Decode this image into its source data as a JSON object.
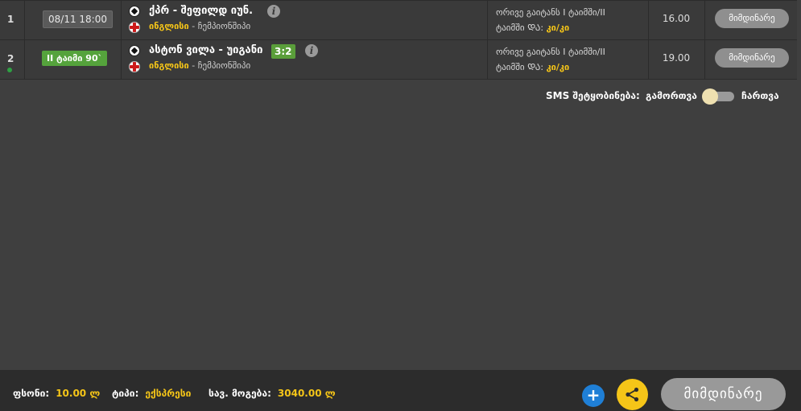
{
  "rows": [
    {
      "index": "1",
      "time": "08/11 18:00",
      "live": false,
      "teams": "ქპრ - შეფილდ იუნ.",
      "score": "",
      "country": "ინგლისი",
      "league": "ჩემპიონშიპი",
      "bet_line1": "ორივე გაიტანს I ტაიმში/II",
      "bet_line2_label": "ტაიმში ‍",
      "bet_line2_sep": "ᲓᲐ",
      "bet_line2_value": "კი/კი",
      "odd": "16.00",
      "status": "მიმდინარე"
    },
    {
      "index": "2",
      "time": "II ტაიმი 90`",
      "live": true,
      "teams": "ასტონ ვილა - უიგანი",
      "score": "3:2",
      "country": "ინგლისი",
      "league": "ჩემპიონშიპი",
      "bet_line1": "ორივე გაიტანს I ტაიმში/II",
      "bet_line2_label": "ტაიმში ‍",
      "bet_line2_sep": "ᲓᲐ",
      "bet_line2_value": "კი/კი",
      "odd": "19.00",
      "status": "მიმდინარე"
    }
  ],
  "sms": {
    "label": "SMS შეტყობინება:",
    "off_label": "გამორთვა",
    "on_label": "ჩართვა",
    "enabled": false
  },
  "footer": {
    "stake_label": "ფსონი:",
    "stake_value": "10.00 ლ",
    "type_label": "ტიპი:",
    "type_value": "ექსპრესი",
    "win_label": "სავ. მოგება:",
    "win_value": "3040.00 ლ",
    "status_button": "მიმდინარე"
  },
  "colors": {
    "accent": "#f5c518",
    "live": "#55a33c",
    "plus": "#1f7fd6"
  }
}
